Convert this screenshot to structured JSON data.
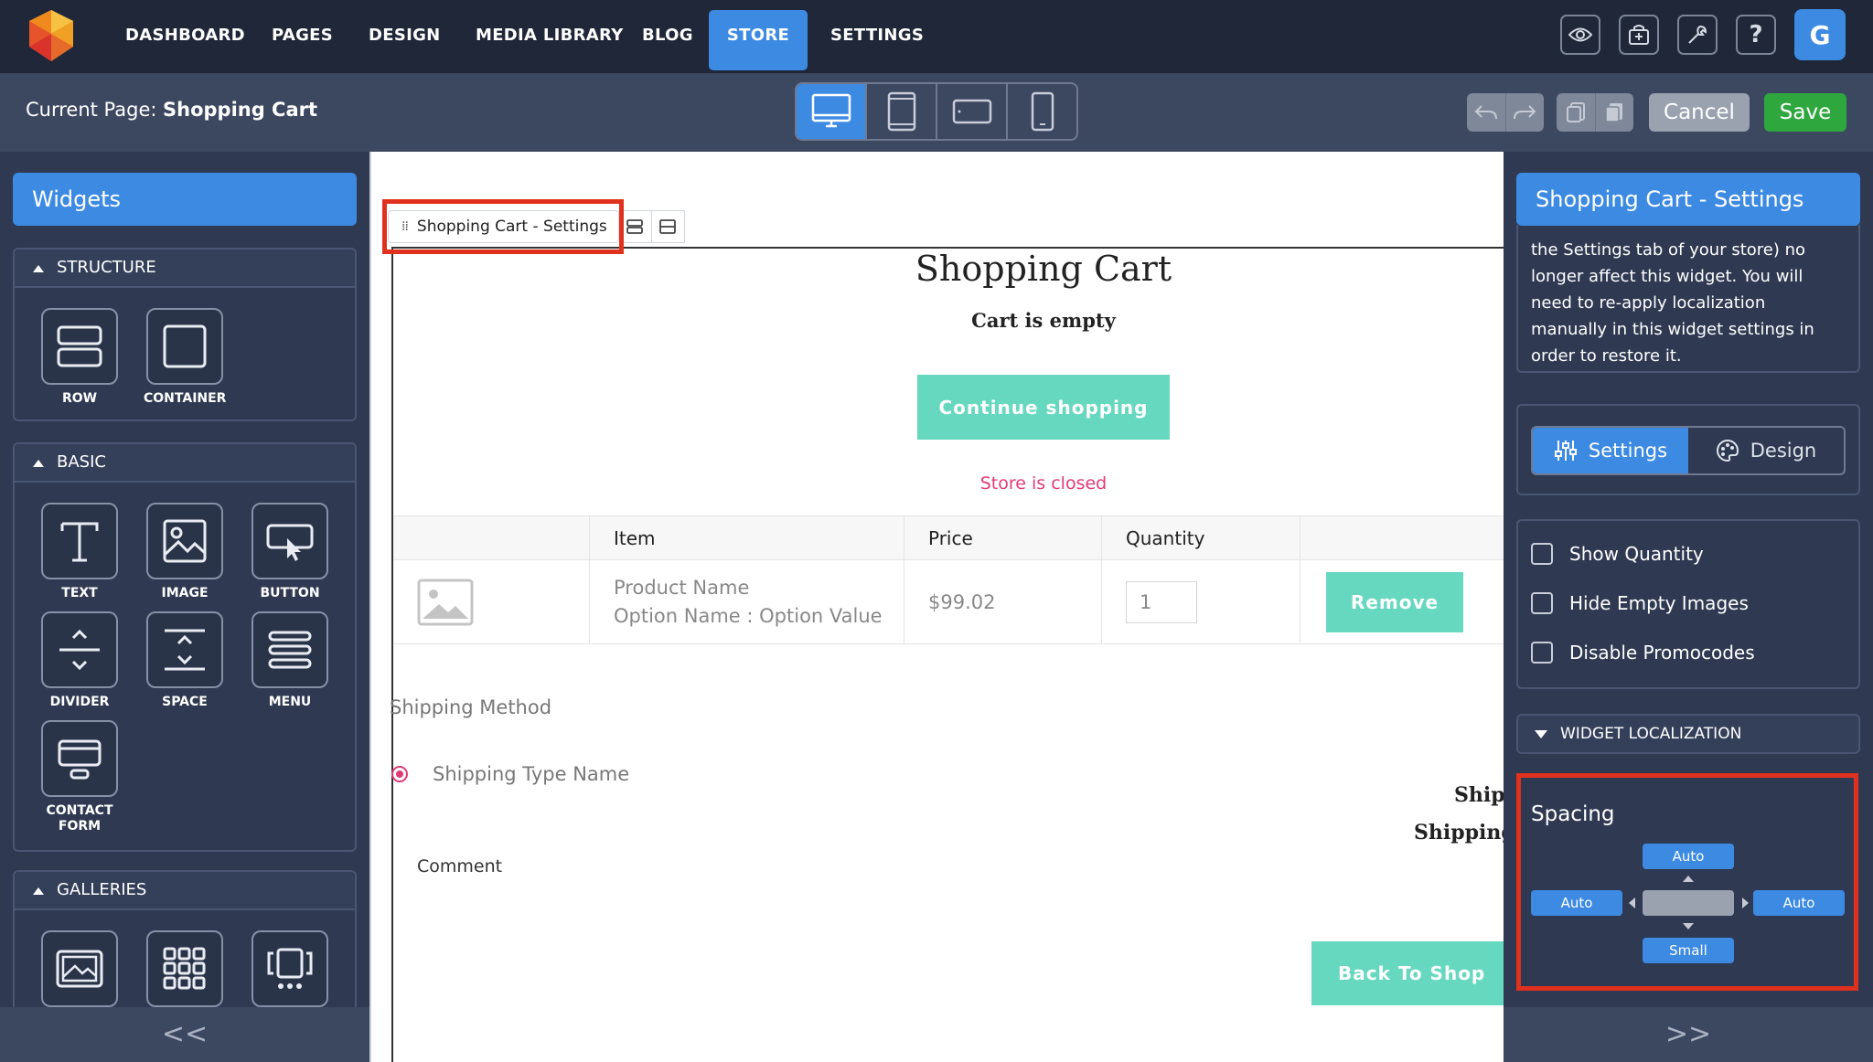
{
  "topnav": {
    "items": [
      "DASHBOARD",
      "PAGES",
      "DESIGN",
      "MEDIA LIBRARY",
      "BLOG",
      "STORE",
      "SETTINGS"
    ],
    "active": "STORE",
    "avatar_letter": "G"
  },
  "subbar": {
    "current_page_label": "Current Page:",
    "current_page_value": "Shopping Cart",
    "cancel_label": "Cancel",
    "save_label": "Save"
  },
  "left_panel": {
    "title": "Widgets",
    "sections": [
      {
        "title": "STRUCTURE",
        "widgets": [
          "ROW",
          "CONTAINER"
        ]
      },
      {
        "title": "BASIC",
        "widgets": [
          "TEXT",
          "IMAGE",
          "BUTTON",
          "DIVIDER",
          "SPACE",
          "MENU",
          "CONTACT FORM"
        ]
      },
      {
        "title": "GALLERIES",
        "widgets": [
          "",
          "",
          ""
        ]
      }
    ],
    "collapse_label": "<<"
  },
  "canvas": {
    "breadcrumb": "Shopping Cart - Settings",
    "title": "Shopping Cart",
    "empty_text": "Cart is empty",
    "continue_label": "Continue shopping",
    "store_closed": "Store is closed",
    "table": {
      "headers": [
        "",
        "Item",
        "Price",
        "Quantity",
        ""
      ],
      "row": {
        "product_name": "Product Name",
        "option": "Option Name : Option Value",
        "price": "$99.02",
        "quantity": "1",
        "remove_label": "Remove"
      }
    },
    "shipping_method_label": "Shipping Method",
    "shipping_type_label": "Shipping Type Name",
    "shipping_right_1": "Ship",
    "shipping_right_2": "Shipping",
    "comment_label": "Comment",
    "back_label": "Back To Shop"
  },
  "right_panel": {
    "title": "Shopping Cart - Settings",
    "info_text": "the Settings tab of your store) no longer affect this widget. You will need to re-apply localization manually in this widget settings in order to restore it.",
    "tabs": [
      "Settings",
      "Design"
    ],
    "active_tab": "Settings",
    "checkboxes": [
      {
        "label": "Show Quantity",
        "checked": false
      },
      {
        "label": "Hide Empty Images",
        "checked": false
      },
      {
        "label": "Disable Promocodes",
        "checked": false
      }
    ],
    "localization_label": "WIDGET LOCALIZATION",
    "spacing": {
      "title": "Spacing",
      "top": "Auto",
      "left": "Auto",
      "right": "Auto",
      "bottom": "Small"
    },
    "collapse_label": ">>"
  },
  "colors": {
    "topbar": "#1f2738",
    "accent": "#3d8ae3",
    "teal_button": "#67d8c0",
    "save_green": "#2fa73f",
    "highlight_red": "#e0311f",
    "store_closed_pink": "#e23a78"
  }
}
